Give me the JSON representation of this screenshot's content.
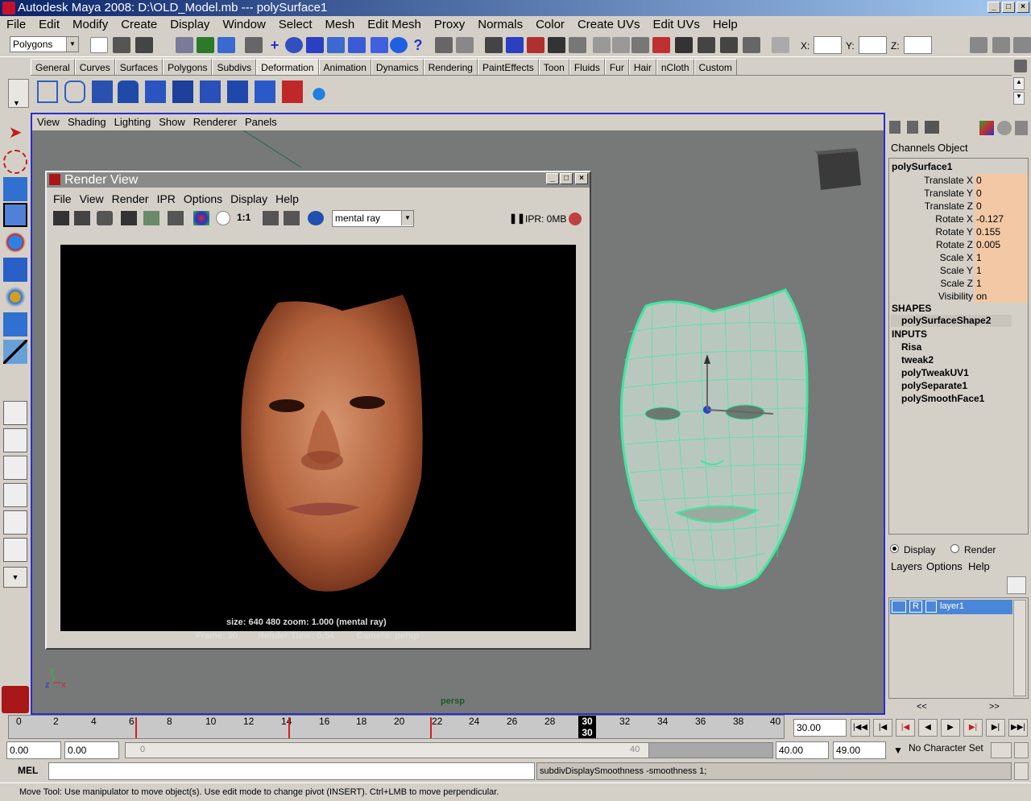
{
  "window": {
    "title": "Autodesk Maya 2008: D:\\OLD_Model.mb   ---   polySurface1"
  },
  "menubar": [
    "File",
    "Edit",
    "Modify",
    "Create",
    "Display",
    "Window",
    "Select",
    "Mesh",
    "Edit Mesh",
    "Proxy",
    "Normals",
    "Color",
    "Create UVs",
    "Edit UVs",
    "Help"
  ],
  "statusline": {
    "mode_selector": "Polygons",
    "x_label": "X:",
    "y_label": "Y:",
    "z_label": "Z:",
    "x_value": "",
    "y_value": "",
    "z_value": ""
  },
  "shelf_tabs": [
    "General",
    "Curves",
    "Surfaces",
    "Polygons",
    "Subdivs",
    "Deformation",
    "Animation",
    "Dynamics",
    "Rendering",
    "PaintEffects",
    "Toon",
    "Fluids",
    "Fur",
    "Hair",
    "nCloth",
    "Custom"
  ],
  "active_shelf_tab": "Deformation",
  "viewport": {
    "menu": [
      "View",
      "Shading",
      "Lighting",
      "Show",
      "Renderer",
      "Panels"
    ],
    "camera_label": "persp",
    "axis_y": "y",
    "axis_z": "z",
    "axis_x": "x"
  },
  "render_view": {
    "title": "Render View",
    "menu": [
      "File",
      "View",
      "Render",
      "IPR",
      "Options",
      "Display",
      "Help"
    ],
    "renderer": "mental ray",
    "ratio_label": "1:1",
    "ipr_status": "IPR: 0MB",
    "info_line1": "size:  640  480 zoom: 1.000        (mental ray)",
    "info_frame": "Frame: 30",
    "info_time": "Render Time: 0:54",
    "info_camera": "Camera: persp"
  },
  "channel_box": {
    "tabs": [
      "Channels",
      "Object"
    ],
    "object_name": "polySurface1",
    "attributes": [
      {
        "name": "Translate X",
        "value": "0"
      },
      {
        "name": "Translate Y",
        "value": "0"
      },
      {
        "name": "Translate Z",
        "value": "0"
      },
      {
        "name": "Rotate X",
        "value": "-0.127"
      },
      {
        "name": "Rotate Y",
        "value": "0.155"
      },
      {
        "name": "Rotate Z",
        "value": "0.005"
      },
      {
        "name": "Scale X",
        "value": "1"
      },
      {
        "name": "Scale Y",
        "value": "1"
      },
      {
        "name": "Scale Z",
        "value": "1"
      },
      {
        "name": "Visibility",
        "value": "on"
      }
    ],
    "shapes_header": "SHAPES",
    "shape_name": "polySurfaceShape2",
    "inputs_header": "INPUTS",
    "inputs": [
      "Risa",
      "tweak2",
      "polyTweakUV1",
      "polySeparate1",
      "polySmoothFace1"
    ]
  },
  "layer_editor": {
    "display_radio": "Display",
    "render_radio": "Render",
    "menu": [
      "Layers",
      "Options",
      "Help"
    ],
    "layer_vis": "",
    "layer_r": "R",
    "layer_name": "layer1",
    "scroll_left": "<<",
    "scroll_right": ">>"
  },
  "time_slider": {
    "ticks": [
      "0",
      "2",
      "4",
      "6",
      "8",
      "10",
      "12",
      "14",
      "16",
      "18",
      "20",
      "22",
      "24",
      "26",
      "28",
      "30",
      "32",
      "34",
      "36",
      "38",
      "40"
    ],
    "current_frame": "30",
    "current_time_field": "30.00"
  },
  "range_slider": {
    "start_time": "0.00",
    "playback_start": "0.00",
    "range_start_label": "0",
    "range_end_label": "40",
    "playback_end": "40.00",
    "end_time": "49.00",
    "character_set": "No Character Set"
  },
  "command_line": {
    "label": "MEL",
    "input": "",
    "result": "subdivDisplaySmoothness -smoothness 1;"
  },
  "help_line": "Move Tool: Use manipulator to move object(s). Use edit mode to change pivot (INSERT).  Ctrl+LMB to move perpendicular."
}
